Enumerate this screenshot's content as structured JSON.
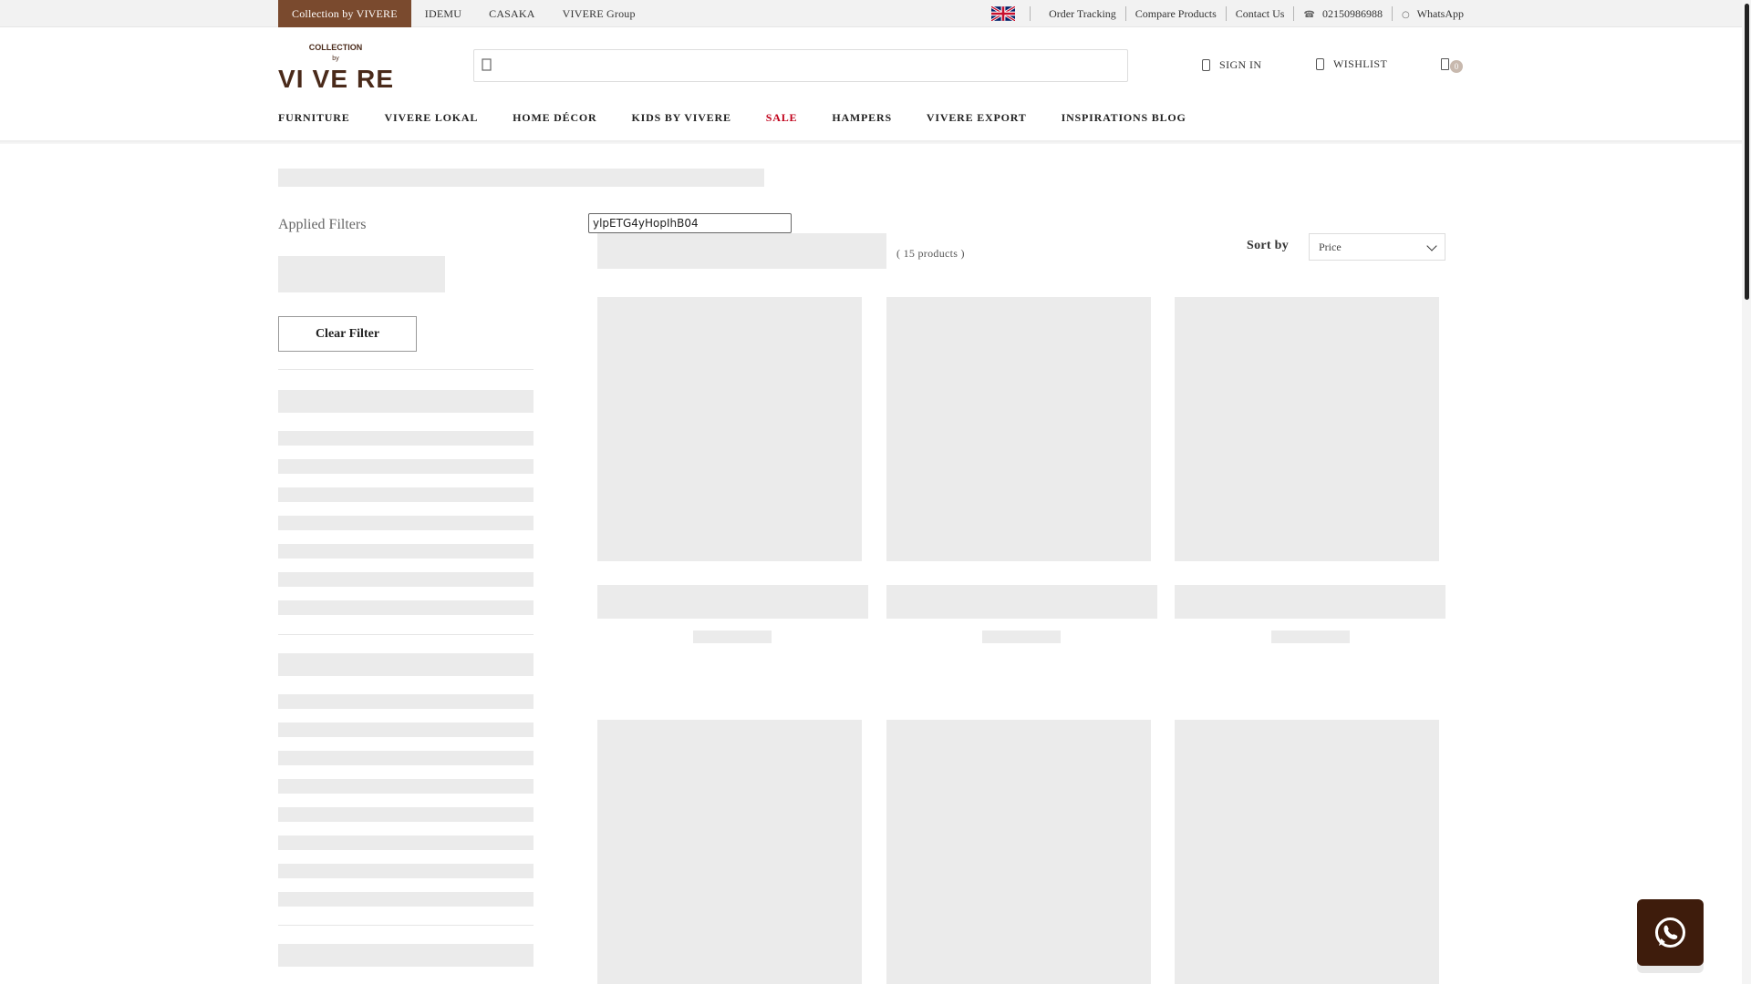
{
  "topbar": {
    "brands": [
      {
        "label": "Collection by VIVERE",
        "active": true
      },
      {
        "label": "IDEMU",
        "active": false
      },
      {
        "label": "CASAKA",
        "active": false
      },
      {
        "label": "VIVERE Group",
        "active": false
      }
    ],
    "language_icon": "uk-flag-icon",
    "links": {
      "order_tracking": "Order Tracking",
      "compare_products": "Compare Products",
      "contact_us": "Contact Us",
      "phone": "02150986988",
      "whatsapp": "WhatsApp"
    }
  },
  "header": {
    "logo": {
      "line1": "COLLECTION",
      "line2": "by",
      "wordmark": "VI VE RE"
    },
    "search_placeholder": "",
    "sign_in": "SIGN IN",
    "wishlist": "WISHLIST",
    "cart_count": "0"
  },
  "nav": {
    "items": [
      {
        "label": "FURNITURE",
        "sale": false
      },
      {
        "label": "VIVERE LOKAL",
        "sale": false
      },
      {
        "label": "HOME DÉCOR",
        "sale": false
      },
      {
        "label": "KIDS BY VIVERE",
        "sale": false
      },
      {
        "label": "SALE",
        "sale": true
      },
      {
        "label": "HAMPERS",
        "sale": false
      },
      {
        "label": "VIVERE EXPORT",
        "sale": false
      },
      {
        "label": "INSPIRATIONS BLOG",
        "sale": false
      }
    ]
  },
  "sidebar": {
    "applied_filters": "Applied Filters",
    "clear_filter": "Clear Filter"
  },
  "listing": {
    "tag_text": "ylpETG4yHopIhB04",
    "count_text": "( 15  products )",
    "sort_label": "Sort by",
    "sort_value": "Price"
  },
  "colors": {
    "brand_brown": "#7a4a2e",
    "sale_red": "#c0001a",
    "whatsapp_bg": "#3e1c0c",
    "skeleton": "#ebebeb"
  }
}
